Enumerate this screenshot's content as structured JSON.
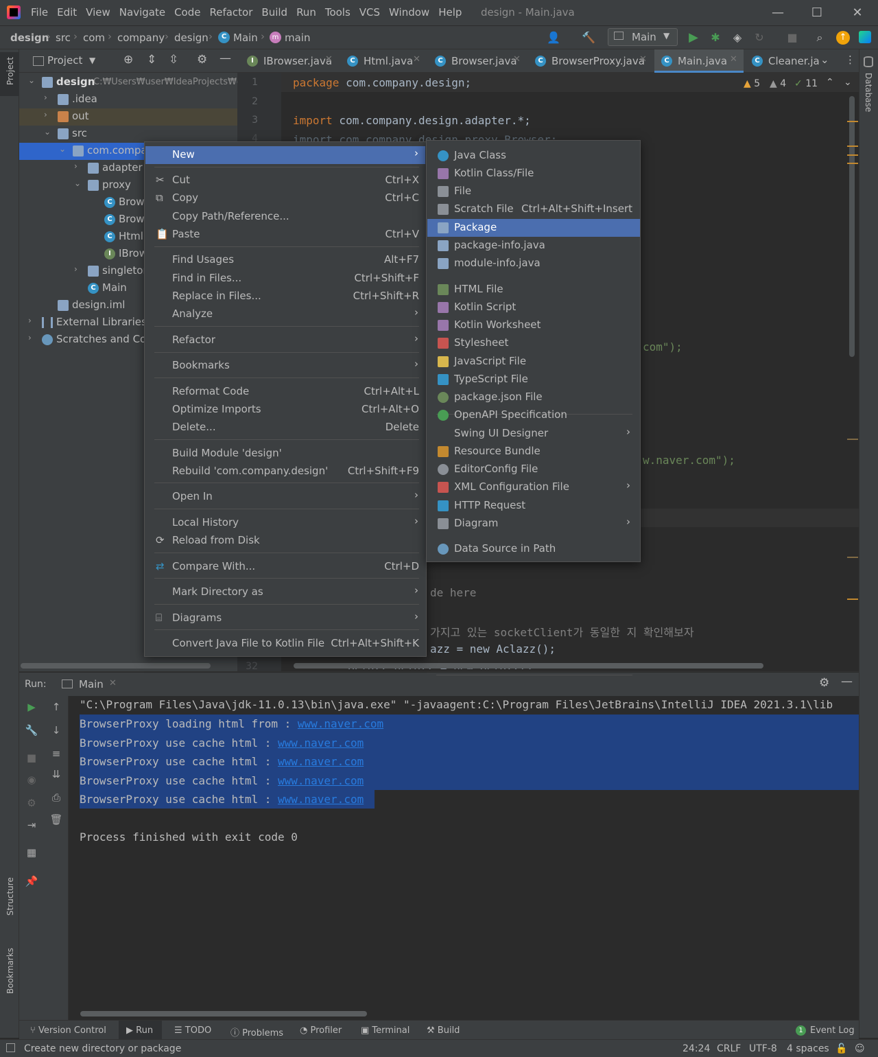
{
  "menubar": {
    "items": [
      "File",
      "Edit",
      "View",
      "Navigate",
      "Code",
      "Refactor",
      "Build",
      "Run",
      "Tools",
      "VCS",
      "Window",
      "Help"
    ],
    "window_title": "design - Main.java"
  },
  "navbar": {
    "breadcrumbs": [
      "design",
      "src",
      "com",
      "company",
      "design",
      "Main",
      "main"
    ],
    "run_config": "Main"
  },
  "project_panel": {
    "title": "Project",
    "tree": [
      {
        "label": "design",
        "path": "C:₩Users₩user₩IdeaProjects₩d"
      },
      {
        "label": ".idea"
      },
      {
        "label": "out"
      },
      {
        "label": "src"
      },
      {
        "label": "com.compar"
      },
      {
        "label": "adapter"
      },
      {
        "label": "proxy"
      },
      {
        "label": "Brows"
      },
      {
        "label": "Brows"
      },
      {
        "label": "Html"
      },
      {
        "label": "IBrow"
      },
      {
        "label": "singletor"
      },
      {
        "label": "Main"
      },
      {
        "label": "design.iml"
      },
      {
        "label": "External Libraries"
      },
      {
        "label": "Scratches and Con"
      }
    ]
  },
  "editor": {
    "tabs": [
      "IBrowser.java",
      "Html.java",
      "Browser.java",
      "BrowserProxy.java",
      "Main.java",
      "Cleaner.ja"
    ],
    "inspections": {
      "warnings": "5",
      "weak_warnings": "4",
      "ok": "11"
    },
    "line_numbers": [
      "1",
      "2",
      "3",
      "4",
      "32"
    ],
    "lines": {
      "l1_kw": "package",
      "l1_rest": " com.company.design;",
      "l3_kw": "import",
      "l3_rest": " com.company.design.adapter.*;",
      "l4": "import com.company.design.proxy.Browser;",
      "frag_com": "com\");",
      "frag_naver": "w.naver.com\");",
      "frag_here": "de here",
      "frag_korean": "가지고 있는 socketClient가 동일한 지 확인해보자",
      "frag_aclazz": "azz = new Aclazz();",
      "frag_bclazz": "Bclazz bclazz = new Bclazz();"
    }
  },
  "context_menu": {
    "items": [
      {
        "label": "New",
        "shortcut": ""
      },
      {
        "label": "Cut",
        "shortcut": "Ctrl+X"
      },
      {
        "label": "Copy",
        "shortcut": "Ctrl+C"
      },
      {
        "label": "Copy Path/Reference...",
        "shortcut": ""
      },
      {
        "label": "Paste",
        "shortcut": "Ctrl+V"
      },
      {
        "label": "Find Usages",
        "shortcut": "Alt+F7"
      },
      {
        "label": "Find in Files...",
        "shortcut": "Ctrl+Shift+F"
      },
      {
        "label": "Replace in Files...",
        "shortcut": "Ctrl+Shift+R"
      },
      {
        "label": "Analyze",
        "shortcut": ""
      },
      {
        "label": "Refactor",
        "shortcut": ""
      },
      {
        "label": "Bookmarks",
        "shortcut": ""
      },
      {
        "label": "Reformat Code",
        "shortcut": "Ctrl+Alt+L"
      },
      {
        "label": "Optimize Imports",
        "shortcut": "Ctrl+Alt+O"
      },
      {
        "label": "Delete...",
        "shortcut": "Delete"
      },
      {
        "label": "Build Module 'design'",
        "shortcut": ""
      },
      {
        "label": "Rebuild 'com.company.design'",
        "shortcut": "Ctrl+Shift+F9"
      },
      {
        "label": "Open In",
        "shortcut": ""
      },
      {
        "label": "Local History",
        "shortcut": ""
      },
      {
        "label": "Reload from Disk",
        "shortcut": ""
      },
      {
        "label": "Compare With...",
        "shortcut": "Ctrl+D"
      },
      {
        "label": "Mark Directory as",
        "shortcut": ""
      },
      {
        "label": "Diagrams",
        "shortcut": ""
      },
      {
        "label": "Convert Java File to Kotlin File",
        "shortcut": "Ctrl+Alt+Shift+K"
      }
    ]
  },
  "new_submenu": {
    "items": [
      {
        "label": "Java Class",
        "shortcut": ""
      },
      {
        "label": "Kotlin Class/File",
        "shortcut": ""
      },
      {
        "label": "File",
        "shortcut": ""
      },
      {
        "label": "Scratch File",
        "shortcut": "Ctrl+Alt+Shift+Insert"
      },
      {
        "label": "Package",
        "shortcut": ""
      },
      {
        "label": "package-info.java",
        "shortcut": ""
      },
      {
        "label": "module-info.java",
        "shortcut": ""
      },
      {
        "label": "HTML File",
        "shortcut": ""
      },
      {
        "label": "Kotlin Script",
        "shortcut": ""
      },
      {
        "label": "Kotlin Worksheet",
        "shortcut": ""
      },
      {
        "label": "Stylesheet",
        "shortcut": ""
      },
      {
        "label": "JavaScript File",
        "shortcut": ""
      },
      {
        "label": "TypeScript File",
        "shortcut": ""
      },
      {
        "label": "package.json File",
        "shortcut": ""
      },
      {
        "label": "OpenAPI Specification",
        "shortcut": ""
      },
      {
        "label": "Swing UI Designer",
        "shortcut": ""
      },
      {
        "label": "Resource Bundle",
        "shortcut": ""
      },
      {
        "label": "EditorConfig File",
        "shortcut": ""
      },
      {
        "label": "XML Configuration File",
        "shortcut": ""
      },
      {
        "label": "HTTP Request",
        "shortcut": ""
      },
      {
        "label": "Diagram",
        "shortcut": ""
      },
      {
        "label": "Data Source in Path",
        "shortcut": ""
      }
    ],
    "highlighted": "Package"
  },
  "run_panel": {
    "label": "Run:",
    "tab": "Main",
    "command": "\"C:\\Program Files\\Java\\jdk-11.0.13\\bin\\java.exe\" \"-javaagent:C:\\Program Files\\JetBrains\\IntelliJ IDEA 2021.3.1\\lib",
    "output": [
      {
        "text": "BrowserProxy loading html from : ",
        "link": "www.naver.com"
      },
      {
        "text": "BrowserProxy use cache html : ",
        "link": "www.naver.com"
      },
      {
        "text": "BrowserProxy use cache html : ",
        "link": "www.naver.com"
      },
      {
        "text": "BrowserProxy use cache html : ",
        "link": "www.naver.com"
      },
      {
        "text": "BrowserProxy use cache html : ",
        "link": "www.naver.com"
      }
    ],
    "exit": "Process finished with exit code 0"
  },
  "bottom_tools": [
    "Version Control",
    "Run",
    "TODO",
    "Problems",
    "Profiler",
    "Terminal",
    "Build"
  ],
  "event_log": {
    "count": "1",
    "label": "Event Log"
  },
  "side_labels": {
    "project": "Project",
    "structure": "Structure",
    "bookmarks": "Bookmarks",
    "database": "Database"
  },
  "statusbar": {
    "message": "Create new directory or package",
    "position": "24:24",
    "line_sep": "CRLF",
    "encoding": "UTF-8",
    "indent": "4 spaces"
  },
  "colors": {
    "accent": "#4b6eaf",
    "selection": "#214283",
    "keyword": "#cc7832",
    "string": "#6a8759",
    "link": "#287bde"
  }
}
